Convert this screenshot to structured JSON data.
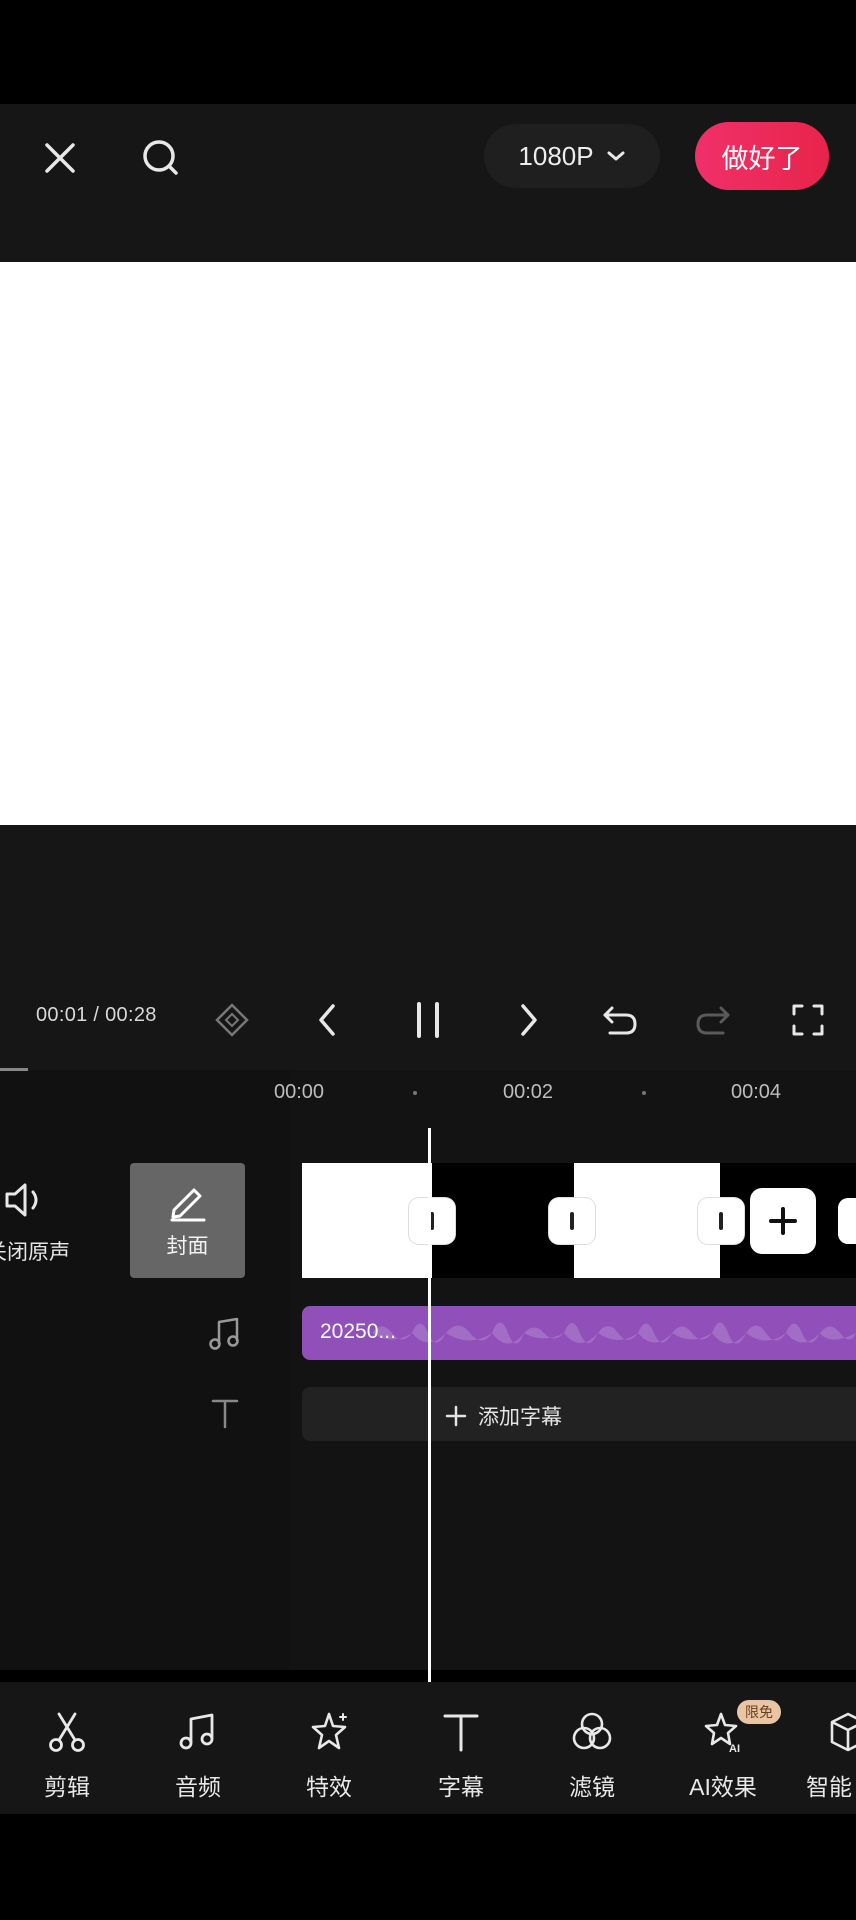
{
  "header": {
    "resolution_label": "1080P",
    "done_label": "做好了"
  },
  "playback": {
    "time_display": "00:01 / 00:28"
  },
  "timeline": {
    "ruler": [
      "00:00",
      "00:02",
      "00:04"
    ],
    "mute_label": "关闭原声",
    "cover_label": "封面",
    "audio_clip_label": "20250...",
    "add_subtitle_label": "添加字幕"
  },
  "toolbar": {
    "items": [
      {
        "label": "剪辑",
        "icon": "scissors-icon"
      },
      {
        "label": "音频",
        "icon": "music-note-icon"
      },
      {
        "label": "特效",
        "icon": "sparkle-star-icon"
      },
      {
        "label": "字幕",
        "icon": "text-t-icon"
      },
      {
        "label": "滤镜",
        "icon": "filter-circles-icon"
      },
      {
        "label": "AI效果",
        "icon": "ai-star-icon"
      },
      {
        "label": "智能",
        "icon": "cube-icon"
      }
    ],
    "badge_label": "限免"
  },
  "colors": {
    "accent": "#e8244a",
    "audio_track": "#9150b9",
    "background": "#161616"
  }
}
